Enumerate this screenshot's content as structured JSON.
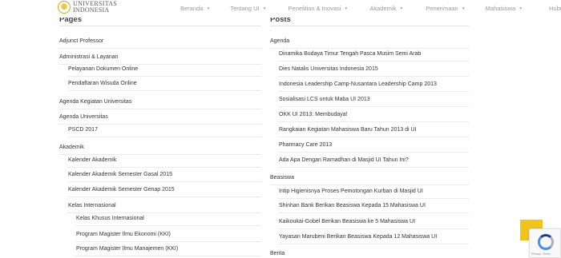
{
  "brand": {
    "line1": "UNIVERSITAS",
    "line2": "INDONESIA"
  },
  "nav": [
    {
      "label": "Beranda",
      "has_menu": true
    },
    {
      "label": "Tentang UI",
      "has_menu": true
    },
    {
      "label": "Penelitian & Inovasi",
      "has_menu": true
    },
    {
      "label": "Akademik",
      "has_menu": true
    },
    {
      "label": "Penerimaan",
      "has_menu": true
    },
    {
      "label": "Mahasiswa",
      "has_menu": true
    },
    {
      "label": "Hubungi Kami",
      "has_menu": false
    }
  ],
  "caret_glyph": "▼",
  "pages": {
    "title": "Pages",
    "items": [
      {
        "label": "Adjunct Professor",
        "level": 0
      },
      {
        "label": "Administrasi & Layanan",
        "level": 0
      },
      {
        "label": "Pelayanan Dokumen Online",
        "level": 1
      },
      {
        "label": "Pendaftaran Wisuda Online",
        "level": 1
      },
      {
        "label": "Agenda Kegiatan Universitas",
        "level": 0
      },
      {
        "label": "Agenda Universitas",
        "level": 0
      },
      {
        "label": "PSCD 2017",
        "level": 1
      },
      {
        "label": "Akademik",
        "level": 0
      },
      {
        "label": "Kalender Akademik",
        "level": 1
      },
      {
        "label": "Kalender Akademik Semester Gasal 2015",
        "level": 1
      },
      {
        "label": "Kalender Akademik Semester Genap 2015",
        "level": 1
      },
      {
        "label": "Kelas Internasional",
        "level": 1
      },
      {
        "label": "Kelas Khusus Internasional",
        "level": 2
      },
      {
        "label": "Program Magister Ilmu Ekonomi (KKI)",
        "level": 2
      },
      {
        "label": "Program Magister Ilmu Manajemen (KKI)",
        "level": 2
      }
    ]
  },
  "posts": {
    "title": "Posts",
    "items": [
      {
        "label": "Agenda",
        "level": 0
      },
      {
        "label": "Dinamika Budaya Timur Tengah Pasca Musim Semi Arab",
        "level": 1
      },
      {
        "label": "Dies Natalis Universitas Indonesia 2015",
        "level": 1
      },
      {
        "label": "Indonesia Leadership Camp-Nusantara Leadership Camp 2013",
        "level": 1
      },
      {
        "label": "Sosialisasi LCS untuk Maba UI 2013",
        "level": 1
      },
      {
        "label": "OKK UI 2013: Membudaya!",
        "level": 1
      },
      {
        "label": "Rangkaian Kegiatan Mahasiswa Baru Tahun 2013 di UI",
        "level": 1
      },
      {
        "label": "Pharmacy Care 2013",
        "level": 1
      },
      {
        "label": "Ada Apa Dengan Ramadhan di Masjid UI Tahun Ini?",
        "level": 1
      },
      {
        "label": "Beasiswa",
        "level": 0
      },
      {
        "label": "Intip Higienisnya Proses Pemotongan Kurban di Masjid UI",
        "level": 1
      },
      {
        "label": "Shinhan Bank Berikan Beasiswa Kepada 15 Mahasiswa UI",
        "level": 1
      },
      {
        "label": "Kaikoukai-Gobel Berikan Beasiswa ke 5 Mahasiswa UI",
        "level": 1
      },
      {
        "label": "Yayasan Marubeni Berikan Beasiswa Kepada 12 Mahasiswa UI",
        "level": 1
      },
      {
        "label": "Berita",
        "level": 0
      }
    ]
  },
  "scroll_top_glyph": "▲",
  "recaptcha": {
    "text": "Privacy - Terms"
  },
  "colors": {
    "accent": "#f2c318",
    "recaptcha_blue": "#4a8af4"
  }
}
